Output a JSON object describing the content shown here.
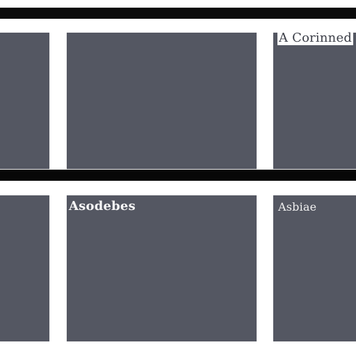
{
  "captions": {
    "top_right": "A Corinned",
    "bottom_middle": "Asodebes",
    "bottom_right": "Asbiae"
  },
  "colors": {
    "panel": "#545762",
    "bar": "#0b0b0b",
    "background": "#ffffff"
  }
}
